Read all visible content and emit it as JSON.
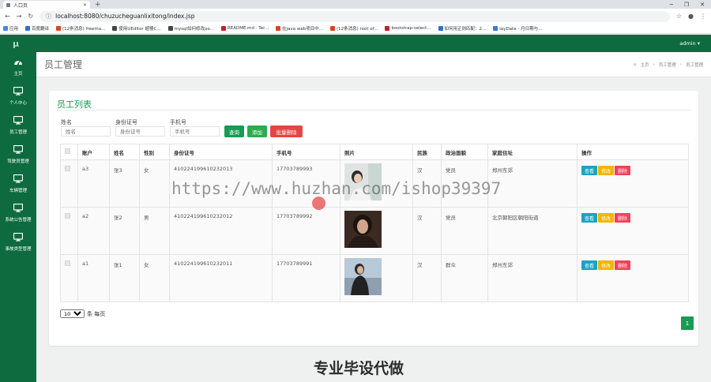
{
  "browser": {
    "tab_title": "人口页",
    "url": "localhost:8080/chuzucheguanlixitong/index.jsp",
    "bookmarks": [
      {
        "label": "应用",
        "color": "#4285f4"
      },
      {
        "label": "百度翻译",
        "color": "#2b6fd6"
      },
      {
        "label": "(12条消息) freema...",
        "color": "#e2401c"
      },
      {
        "label": "使用UEditor 超慢C...",
        "color": "#444444"
      },
      {
        "label": "mysql如何修改oo...",
        "color": "#444444"
      },
      {
        "label": "README.md · Ter...",
        "color": "#c71d23"
      },
      {
        "label": "在java web项目中...",
        "color": "#e2401c"
      },
      {
        "label": "(12条消息) root of...",
        "color": "#e2401c"
      },
      {
        "label": "bootstrap-select...",
        "color": "#c71d23"
      },
      {
        "label": "如何用正则匹配：2...",
        "color": "#2b6fd6"
      },
      {
        "label": "layDate - 月日期与...",
        "color": "#3a7bd5"
      }
    ]
  },
  "header": {
    "logo": "μ",
    "user": "admin ▾"
  },
  "sidebar": {
    "items": [
      {
        "label": "主页",
        "icon": "dashboard-icon"
      },
      {
        "label": "个人中心",
        "icon": "monitor-icon"
      },
      {
        "label": "员工管理",
        "icon": "monitor-icon"
      },
      {
        "label": "驾驶员管理",
        "icon": "monitor-icon"
      },
      {
        "label": "车辆管理",
        "icon": "monitor-icon"
      },
      {
        "label": "系统公告管理",
        "icon": "monitor-icon"
      },
      {
        "label": "事故类型管理",
        "icon": "monitor-icon"
      }
    ]
  },
  "page": {
    "title": "员工管理",
    "breadcrumb": [
      "主页",
      "员工管理",
      "员工管理"
    ]
  },
  "list": {
    "title": "员工列表",
    "filters": [
      {
        "label": "姓名",
        "placeholder": "姓名"
      },
      {
        "label": "身份证号",
        "placeholder": "身份证号"
      },
      {
        "label": "手机号",
        "placeholder": "手机号"
      }
    ],
    "buttons": {
      "search": "查询",
      "add": "添加",
      "batch_delete": "批量删除"
    },
    "columns": [
      "账户",
      "姓名",
      "性别",
      "身份证号",
      "手机号",
      "照片",
      "民族",
      "政治面貌",
      "家庭住址",
      "操作"
    ],
    "rows": [
      {
        "account": "a3",
        "name": "张3",
        "gender": "女",
        "id_no": "410224199610232013",
        "phone": "17703789993",
        "ethnicity": "汉",
        "political": "党员",
        "address": "郑州东郊"
      },
      {
        "account": "a2",
        "name": "张2",
        "gender": "男",
        "id_no": "410224199610232012",
        "phone": "17703789992",
        "ethnicity": "汉",
        "political": "党员",
        "address": "北京朝阳区朝阳街道"
      },
      {
        "account": "a1",
        "name": "张1",
        "gender": "女",
        "id_no": "410224199610232011",
        "phone": "17703789991",
        "ethnicity": "汉",
        "political": "群众",
        "address": "郑州东郊"
      }
    ],
    "row_actions": {
      "view": "查看",
      "edit": "修改",
      "delete": "删除"
    },
    "page_size": "10",
    "page_size_suffix": "条 每页",
    "current_page": "1"
  },
  "overlay": {
    "watermark": "https://www.huzhan.com/ishop39397",
    "banner": "专业毕设代做"
  },
  "colors": {
    "brand": "#0d6b3f",
    "accent": "#1a9a55",
    "view": "#1ba3c2",
    "edit": "#f5b400",
    "delete": "#f34158",
    "batch": "#e64545"
  }
}
